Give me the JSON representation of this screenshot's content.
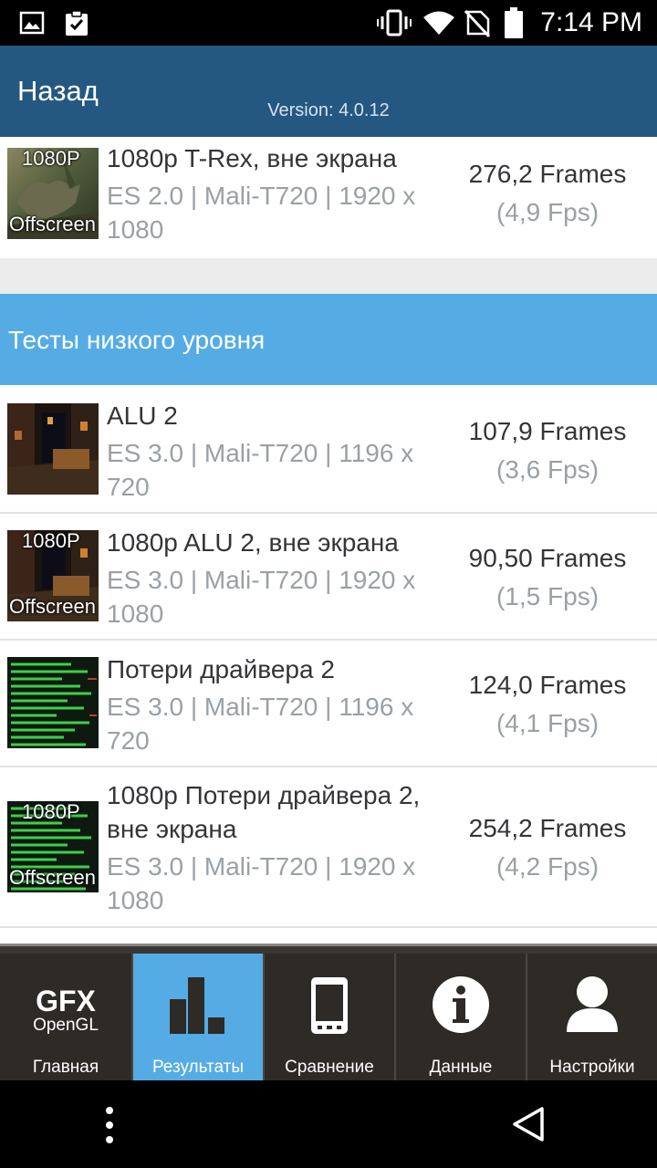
{
  "status_bar": {
    "time": "7:14 PM",
    "left_icons": [
      "image-icon",
      "clipboard-check-icon"
    ],
    "right_icons": [
      "vibrate-icon",
      "wifi-icon",
      "no-sim-icon",
      "battery-icon"
    ]
  },
  "header": {
    "back_label": "Назад",
    "version": "Version: 4.0.12"
  },
  "top_result": {
    "title": "1080p T-Rex, вне экрана",
    "subtitle": "ES 2.0 | Mali-T720 | 1920 x 1080",
    "score": "276,2 Frames",
    "fps": "(4,9 Fps)",
    "badge_top": "1080P",
    "badge_bottom": "Offscreen"
  },
  "section": {
    "title": "Тесты низкого уровня"
  },
  "results": [
    {
      "title": "ALU 2",
      "subtitle": "ES 3.0 | Mali-T720 | 1196 x 720",
      "score": "107,9 Frames",
      "fps": "(3,6 Fps)"
    },
    {
      "title": "1080p ALU 2, вне экрана",
      "subtitle": "ES 3.0 | Mali-T720 | 1920 x 1080",
      "score": "90,50 Frames",
      "fps": "(1,5 Fps)",
      "badge_top": "1080P",
      "badge_bottom": "Offscreen"
    },
    {
      "title": "Потери драйвера 2",
      "subtitle": "ES 3.0 | Mali-T720 | 1196 x 720",
      "score": "124,0 Frames",
      "fps": "(4,1 Fps)"
    },
    {
      "title": "1080p Потери драйвера 2, вне экрана",
      "subtitle": "ES 3.0 | Mali-T720 | 1920 x 1080",
      "score": "254,2 Frames",
      "fps": "(4,2 Fps)",
      "badge_top": "1080P",
      "badge_bottom": "Offscreen"
    }
  ],
  "tabs": [
    {
      "label": "Главная",
      "icon": "gfx-opengl-logo",
      "logo_top": "GFX",
      "logo_bottom": "OpenGL",
      "active": false
    },
    {
      "label": "Результаты",
      "icon": "bar-chart-icon",
      "active": true
    },
    {
      "label": "Сравнение",
      "icon": "phone-icon",
      "active": false
    },
    {
      "label": "Данные",
      "icon": "info-icon",
      "active": false
    },
    {
      "label": "Настройки",
      "icon": "user-icon",
      "active": false
    }
  ],
  "nav_bar": {
    "icons": [
      "menu-dots-icon",
      "back-triangle-icon"
    ]
  },
  "colors": {
    "header": "#255880",
    "section": "#55ace5",
    "active_tab": "#55ace5",
    "tab_bar": "#3a3632"
  }
}
